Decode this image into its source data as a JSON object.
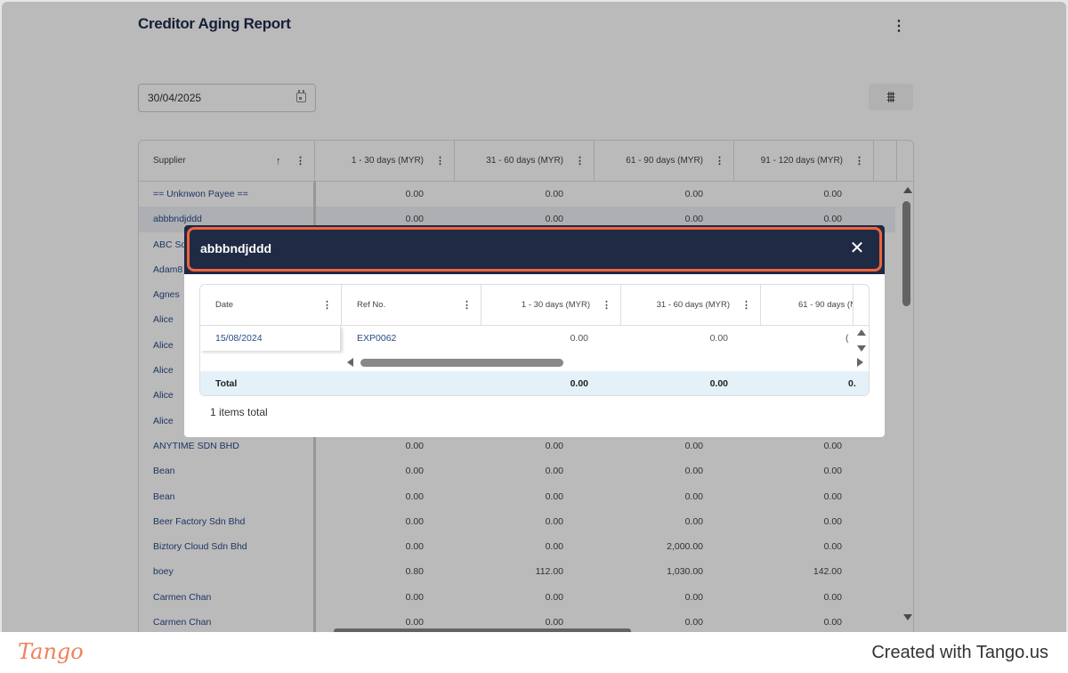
{
  "page": {
    "title": "Creditor Aging Report",
    "more_icon": "⋮"
  },
  "filters": {
    "date": "30/04/2025",
    "filter_icon": "⩩"
  },
  "grid": {
    "columns": {
      "supplier": "Supplier",
      "c1": "1 - 30 days (MYR)",
      "c2": "31 - 60 days (MYR)",
      "c3": "61 - 90 days (MYR)",
      "c4": "91 - 120 days (MYR)"
    },
    "sort_icon": "↑",
    "col_menu_icon": "⋮",
    "rows": [
      {
        "supplier": "== Unknwon Payee ==",
        "c1": "0.00",
        "c2": "0.00",
        "c3": "0.00",
        "c4": "0.00"
      },
      {
        "supplier": "abbbndjddd",
        "c1": "0.00",
        "c2": "0.00",
        "c3": "0.00",
        "c4": "0.00"
      },
      {
        "supplier": "ABC Sd",
        "c1": "",
        "c2": "",
        "c3": "",
        "c4": ""
      },
      {
        "supplier": "Adam8",
        "c1": "",
        "c2": "",
        "c3": "",
        "c4": ""
      },
      {
        "supplier": "Agnes",
        "c1": "",
        "c2": "",
        "c3": "",
        "c4": ""
      },
      {
        "supplier": "Alice",
        "c1": "",
        "c2": "",
        "c3": "",
        "c4": ""
      },
      {
        "supplier": "Alice",
        "c1": "",
        "c2": "",
        "c3": "",
        "c4": ""
      },
      {
        "supplier": "Alice",
        "c1": "",
        "c2": "",
        "c3": "",
        "c4": ""
      },
      {
        "supplier": "Alice",
        "c1": "",
        "c2": "",
        "c3": "",
        "c4": ""
      },
      {
        "supplier": "Alice",
        "c1": "",
        "c2": "",
        "c3": "",
        "c4": ""
      },
      {
        "supplier": "ANYTIME SDN BHD",
        "c1": "0.00",
        "c2": "0.00",
        "c3": "0.00",
        "c4": "0.00"
      },
      {
        "supplier": "Bean",
        "c1": "0.00",
        "c2": "0.00",
        "c3": "0.00",
        "c4": "0.00"
      },
      {
        "supplier": "Bean",
        "c1": "0.00",
        "c2": "0.00",
        "c3": "0.00",
        "c4": "0.00"
      },
      {
        "supplier": "Beer Factory Sdn Bhd",
        "c1": "0.00",
        "c2": "0.00",
        "c3": "0.00",
        "c4": "0.00"
      },
      {
        "supplier": "Biztory Cloud Sdn Bhd",
        "c1": "0.00",
        "c2": "0.00",
        "c3": "2,000.00",
        "c4": "0.00"
      },
      {
        "supplier": "boey",
        "c1": "0.80",
        "c2": "112.00",
        "c3": "1,030.00",
        "c4": "142.00"
      },
      {
        "supplier": "Carmen Chan",
        "c1": "0.00",
        "c2": "0.00",
        "c3": "0.00",
        "c4": "0.00"
      },
      {
        "supplier": "Carmen Chan",
        "c1": "0.00",
        "c2": "0.00",
        "c3": "0.00",
        "c4": "0.00"
      }
    ]
  },
  "dialog": {
    "title": "abbbndjddd",
    "close_icon": "✕",
    "columns": {
      "date": "Date",
      "ref": "Ref No.",
      "c1": "1 - 30 days (MYR)",
      "c2": "31 - 60 days (MYR)",
      "c3": "61 - 90 days (N"
    },
    "row": {
      "date": "15/08/2024",
      "ref": "EXP0062",
      "c1": "0.00",
      "c2": "0.00",
      "c3": "("
    },
    "total": {
      "label": "Total",
      "c1": "0.00",
      "c2": "0.00",
      "c3": "0."
    },
    "count_text": "1 items total"
  },
  "footer": {
    "logo": "Tango",
    "credit": "Created with Tango.us"
  },
  "colors": {
    "dialog_header": "#1f2a44",
    "highlight": "#f0643c",
    "total_row": "#e4f1f8",
    "link": "#2a4a8a"
  }
}
